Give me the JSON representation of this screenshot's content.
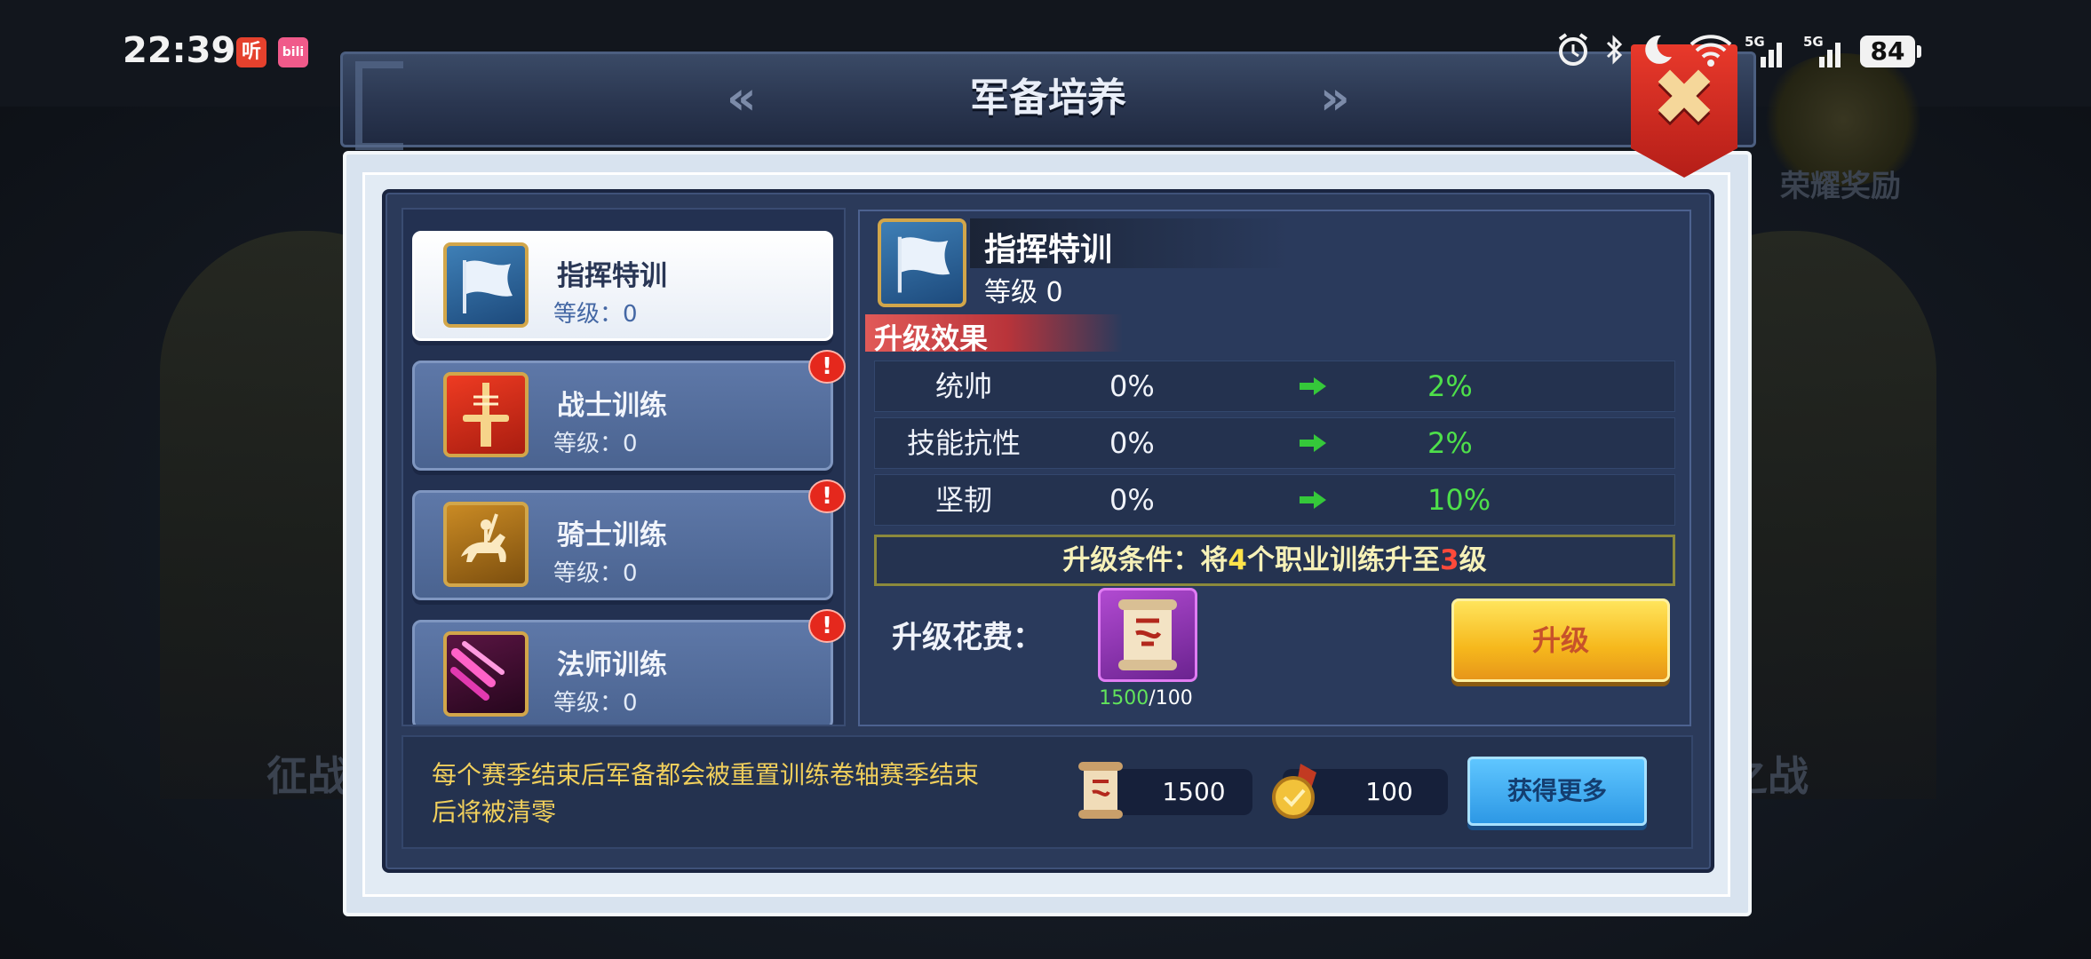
{
  "status_bar": {
    "time": "22:39",
    "app_icons": [
      {
        "name": "listen-app-icon",
        "label": "听"
      },
      {
        "name": "bilibili-app-icon",
        "label": "bili"
      }
    ],
    "signal_labels": [
      "5G",
      "5G"
    ],
    "battery": "84"
  },
  "background": {
    "right_label": "荣耀奖励",
    "left_bottom": "征战",
    "right_bottom": "之战"
  },
  "dialog": {
    "title": "军备培养",
    "prev_icon": "double-chevron-left-icon",
    "next_icon": "double-chevron-right-icon",
    "close_icon": "close-icon"
  },
  "training_list": [
    {
      "name": "指挥特训",
      "level": "等级：0",
      "icon": "flag-icon",
      "selected": true,
      "alert": ""
    },
    {
      "name": "战士训练",
      "level": "等级：0",
      "icon": "sword-icon",
      "selected": false,
      "alert": "!"
    },
    {
      "name": "骑士训练",
      "level": "等级：0",
      "icon": "knight-icon",
      "selected": false,
      "alert": "!"
    },
    {
      "name": "法师训练",
      "level": "等级：0",
      "icon": "mage-icon",
      "selected": false,
      "alert": "!"
    }
  ],
  "detail": {
    "name": "指挥特训",
    "level": "等级 0",
    "effects_title": "升级效果",
    "effects": [
      {
        "stat": "统帅",
        "current": "0%",
        "next": "2%"
      },
      {
        "stat": "技能抗性",
        "current": "0%",
        "next": "2%"
      },
      {
        "stat": "坚韧",
        "current": "0%",
        "next": "10%"
      }
    ],
    "condition": {
      "prefix": "升级条件：",
      "t1": "将",
      "count": "4",
      "t2": "个职业训练升至",
      "target": "3",
      "t3": "级"
    },
    "cost_label": "升级花费：",
    "cost_item_icon": "training-scroll-icon",
    "cost_have": "1500",
    "cost_need": "/100",
    "upgrade_button": "升级"
  },
  "footer": {
    "notice": "每个赛季结束后军备都会被重置训练卷轴赛季结束后将被清零",
    "resources": [
      {
        "icon": "scroll-icon",
        "value": "1500"
      },
      {
        "icon": "medal-icon",
        "value": "100"
      }
    ],
    "get_more_button": "获得更多"
  },
  "colors": {
    "accent_green": "#4ee04a",
    "alert_red": "#e5281d",
    "gold_button": "#f6b81c",
    "blue_button": "#2d98e5"
  }
}
